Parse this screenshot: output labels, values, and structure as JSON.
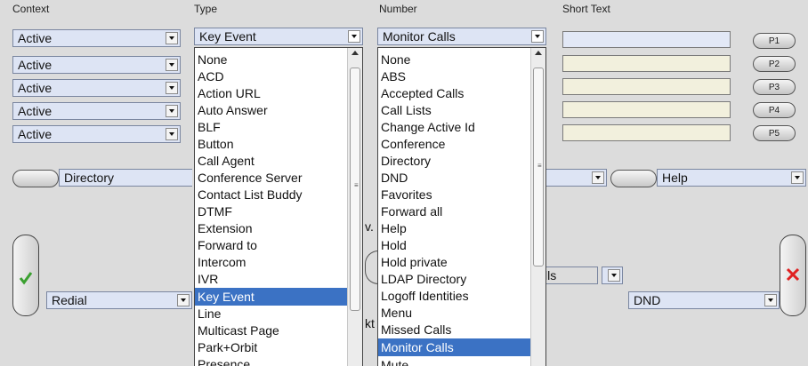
{
  "headers": {
    "context": "Context",
    "type": "Type",
    "number": "Number",
    "short_text": "Short Text"
  },
  "context_rows": [
    "Active",
    "Active",
    "Active",
    "Active",
    "Active"
  ],
  "type_selected": "Key Event",
  "number_selected": "Monitor Calls",
  "p_buttons": [
    "P1",
    "P2",
    "P3",
    "P4",
    "P5"
  ],
  "type_options": [
    "None",
    "ACD",
    "Action URL",
    "Auto Answer",
    "BLF",
    "Button",
    "Call Agent",
    "Conference Server",
    "Contact List Buddy",
    "DTMF",
    "Extension",
    "Forward to",
    "Intercom",
    "IVR",
    "Key Event",
    "Line",
    "Multicast Page",
    "Park+Orbit",
    "Presence"
  ],
  "number_options": [
    "None",
    "ABS",
    "Accepted Calls",
    "Call Lists",
    "Change Active Id",
    "Conference",
    "Directory",
    "DND",
    "Favorites",
    "Forward all",
    "Help",
    "Hold",
    "Hold private",
    "LDAP Directory",
    "Logoff Identities",
    "Menu",
    "Missed Calls",
    "Monitor Calls",
    "Mute"
  ],
  "soft_keys": {
    "directory": "Directory",
    "help": "Help",
    "redial": "Redial",
    "dnd": "DND"
  },
  "fragments": {
    "calls": "lls",
    "v": "v.",
    "kt": "kt"
  },
  "icons": {
    "accept": "check-icon",
    "cancel": "x-icon"
  },
  "colors": {
    "check": "#3aa030",
    "cross": "#e02020",
    "highlight": "#3b72c4"
  }
}
